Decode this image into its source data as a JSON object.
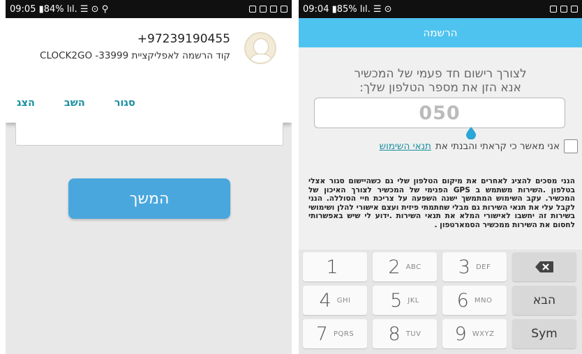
{
  "left_phone": {
    "status_text": "09:05 ▮84% lıl. ☰ ⊙ ⚲",
    "notification": {
      "sender": "+97239190455",
      "message": "קוד הרשמה לאפליקציית CLOCK2GO -33999",
      "actions": [
        "סגור",
        "השב",
        "הצג"
      ]
    },
    "continue_label": "המשך"
  },
  "right_phone": {
    "status_text": "09:04 ▮85% lıl. ☰ ⊙",
    "app_title": "הרשמה",
    "instruction_line1": "לצורך רישום חד פעמי של המכשיר",
    "instruction_line2": "אנא הזן את מספר הטלפון שלך:",
    "phone_value": "050",
    "terms_text": "אני מאשר כי קראתי והבנתי את",
    "terms_link": "תנאי השימוש",
    "consent_text": "הנני מסכים להציג לאחרים את מיקום הטלפון שלי גם כשהיישום סגור אצלי בטלפון .השירות משתמש ב GPS הפנימי של המכשיר לצורך האיכון של המכשיר. עקב השימוש המתמשך ישנה השפעה על צריכת חיי הסוללה. הנני לקבל עלי את תנאי השירות גם מבלי שחתמתי פיזית ועצם אישורי להלן ושימושי בשירות זה יחשבו לאישורי המלא את תנאי השירות .ידוע לי שיש באפשרותי לחסום את השירות ממכשיר הסמארטפון .",
    "keyboard": {
      "rows": [
        [
          {
            "digit": "1",
            "letters": ""
          },
          {
            "digit": "2",
            "letters": "ABC"
          },
          {
            "digit": "3",
            "letters": "DEF"
          },
          {
            "fn": "⌫"
          }
        ],
        [
          {
            "digit": "4",
            "letters": "GHI"
          },
          {
            "digit": "5",
            "letters": "JKL"
          },
          {
            "digit": "6",
            "letters": "MNO"
          },
          {
            "fn": "הבא"
          }
        ],
        [
          {
            "digit": "7",
            "letters": "PQRS"
          },
          {
            "digit": "8",
            "letters": "TUV"
          },
          {
            "digit": "9",
            "letters": "WXYZ"
          },
          {
            "fn": "Sym"
          }
        ]
      ]
    }
  },
  "colors": {
    "app_bar": "#4fc3ef",
    "button": "#4aa7de",
    "link": "#1a8fa0"
  }
}
